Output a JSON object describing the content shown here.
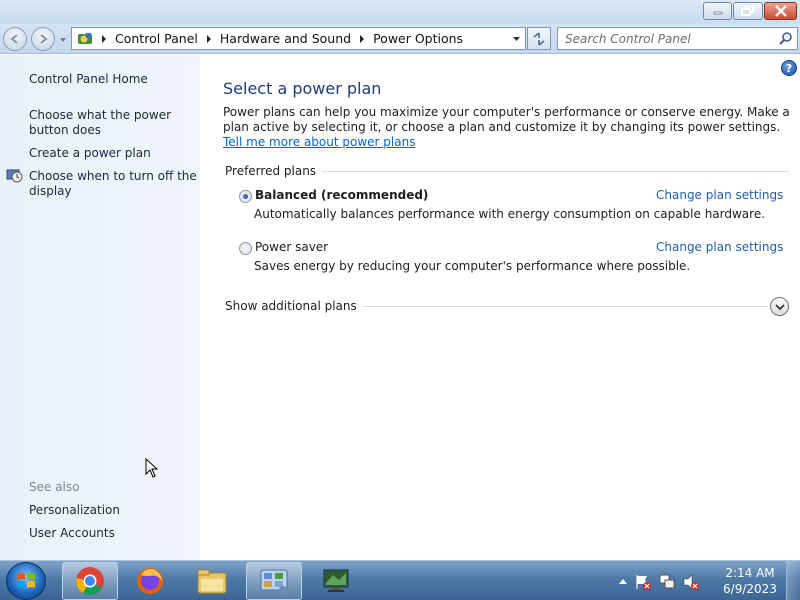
{
  "window": {
    "controls": {
      "minimize": "minimize-icon",
      "maximize": "restore-icon",
      "close": "close-icon"
    }
  },
  "address_bar": {
    "crumbs": [
      "Control Panel",
      "Hardware and Sound",
      "Power Options"
    ],
    "search_placeholder": "Search Control Panel"
  },
  "sidebar": {
    "home": "Control Panel Home",
    "links": [
      "Choose what the power button does",
      "Create a power plan",
      "Choose when to turn off the display"
    ],
    "see_also_heading": "See also",
    "see_also": [
      "Personalization",
      "User Accounts"
    ]
  },
  "main": {
    "title": "Select a power plan",
    "intro": "Power plans can help you maximize your computer's performance or conserve energy. Make a plan active by selecting it, or choose a plan and customize it by changing its power settings.",
    "intro_link": "Tell me more about power plans",
    "preferred_label": "Preferred plans",
    "plans": [
      {
        "name": "Balanced (recommended)",
        "description": "Automatically balances performance with energy consumption on capable hardware.",
        "selected": true,
        "link": "Change plan settings"
      },
      {
        "name": "Power saver",
        "description": "Saves energy by reducing your computer's performance where possible.",
        "selected": false,
        "link": "Change plan settings"
      }
    ],
    "additional_label": "Show additional plans"
  },
  "taskbar": {
    "apps": [
      "chrome-icon",
      "firefox-icon",
      "file-explorer-icon",
      "control-panel-icon",
      "remote-desktop-icon"
    ],
    "time": "2:14 AM",
    "date": "6/9/2023"
  },
  "colors": {
    "link": "#0066cc",
    "title": "#1e3d7a",
    "sidebar_bg": "#e9f0f9"
  }
}
